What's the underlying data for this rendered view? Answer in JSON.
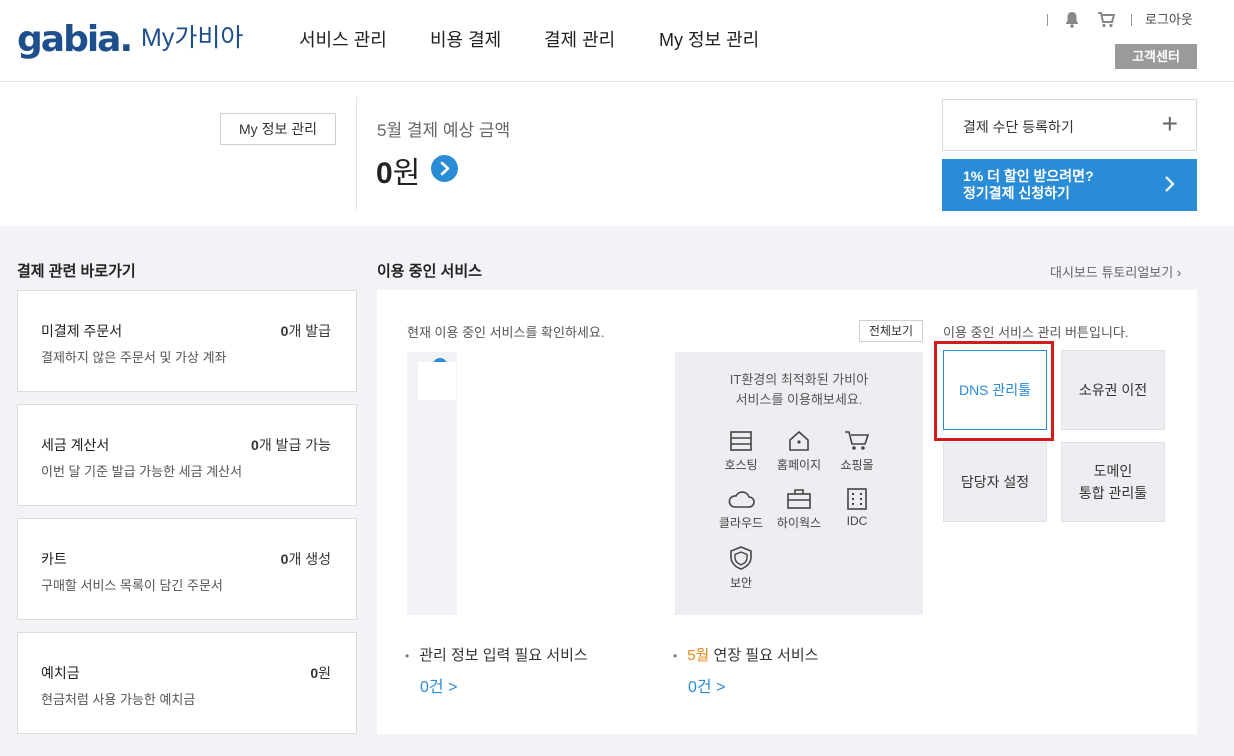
{
  "header": {
    "logo": "gabia.",
    "logo_sub": "My가비아",
    "nav": [
      "서비스 관리",
      "비용 결제",
      "결제 관리",
      "My 정보 관리"
    ],
    "logout": "로그아웃",
    "customer_center": "고객센터"
  },
  "summary": {
    "myinfo_button": "My 정보 관리",
    "payment_label": "5월 결제 예상 금액",
    "payment_amount": "0",
    "payment_unit": "원",
    "register_payment": "결제 수단 등록하기",
    "discount_line1": "1% 더 할인 받으려면?",
    "discount_line2": "정기결제 신청하기"
  },
  "shortcuts": {
    "title": "결제 관련 바로가기",
    "cards": [
      {
        "name": "미결제 주문서",
        "count": "0",
        "suffix": "개 발급",
        "desc": "결제하지 않은 주문서 및 가상 계좌"
      },
      {
        "name": "세금 계산서",
        "count": "0",
        "suffix": "개 발급 가능",
        "desc": "이번 달 기준 발급 가능한 세금 계산서"
      },
      {
        "name": "카트",
        "count": "0",
        "suffix": "개 생성",
        "desc": "구매할 서비스 목록이 담긴 주문서"
      },
      {
        "name": "예치금",
        "count": "0",
        "suffix": "원",
        "desc": "현금처럼 사용 가능한 예치금"
      }
    ]
  },
  "services": {
    "title": "이용 중인 서비스",
    "dashboard_link": "대시보드 튜토리얼보기",
    "hint": "현재 이용 중인 서비스를 확인하세요.",
    "view_all": "전체보기",
    "promo_line1": "IT환경의 최적화된 가비아",
    "promo_line2": "서비스를 이용해보세요.",
    "icons": [
      "호스팅",
      "홈페이지",
      "쇼핑몰",
      "클라우드",
      "하이웍스",
      "IDC",
      "보안"
    ],
    "manager_hint": "이용 중인 서비스 관리 버튼입니다.",
    "buttons": {
      "dns": "DNS 관리툴",
      "transfer": "소유권 이전",
      "contact": "담당자 설정",
      "domain_line1": "도메인",
      "domain_line2": "통합 관리툴"
    },
    "need_info": "관리 정보 입력 필요 서비스",
    "need_info_count": "0건 >",
    "renew_month": "5월",
    "renew_label": " 연장 필요 서비스",
    "renew_count": "0건 >"
  },
  "colors": {
    "accent": "#2a8bd6",
    "logo": "#1d4f8c",
    "highlight": "#d41b1b"
  }
}
